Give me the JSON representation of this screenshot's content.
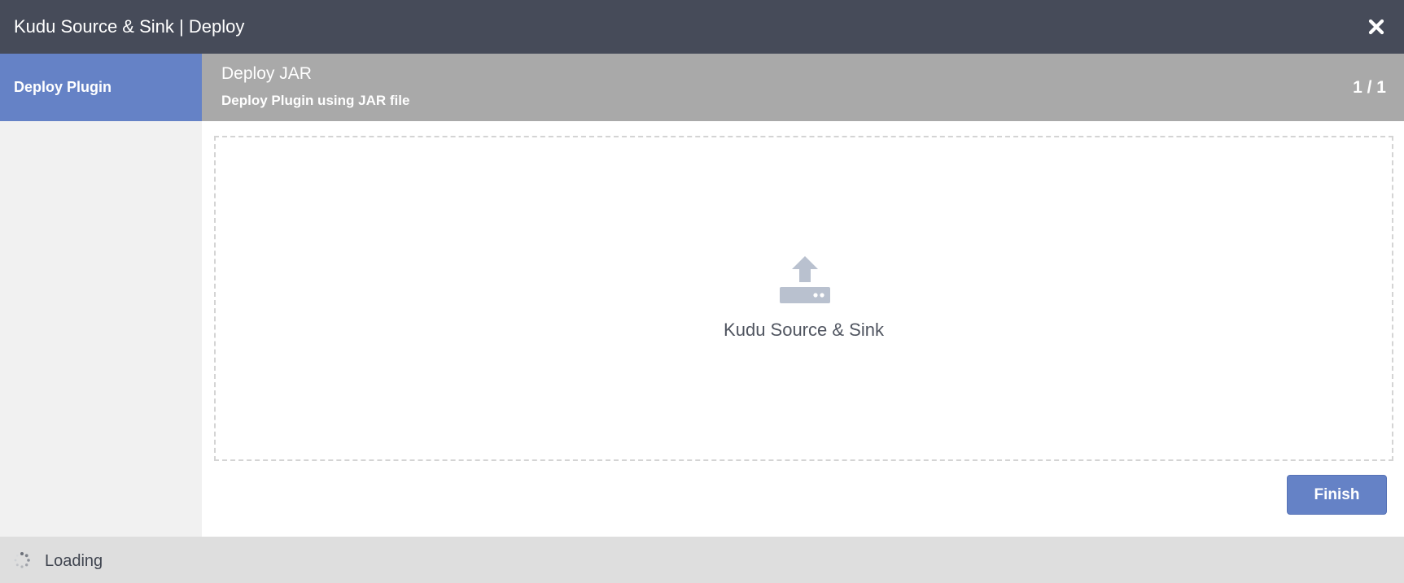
{
  "window": {
    "title": "Kudu Source & Sink | Deploy",
    "close_icon": "close-icon"
  },
  "sidebar": {
    "items": [
      {
        "label": "Deploy Plugin",
        "active": true
      }
    ]
  },
  "step": {
    "title": "Deploy JAR",
    "subtitle": "Deploy Plugin using JAR file",
    "counter": "1 / 1"
  },
  "dropzone": {
    "icon": "upload-icon",
    "label": "Kudu Source & Sink"
  },
  "actions": {
    "finish_label": "Finish"
  },
  "footer": {
    "status_icon": "spinner-icon",
    "status_text": "Loading"
  },
  "colors": {
    "titlebar": "#464b59",
    "accent": "#6582c6",
    "step_header": "#a9a9a9",
    "sidebar": "#f1f1f1",
    "footer": "#dedede",
    "icon_gray": "#b9c1cf"
  }
}
